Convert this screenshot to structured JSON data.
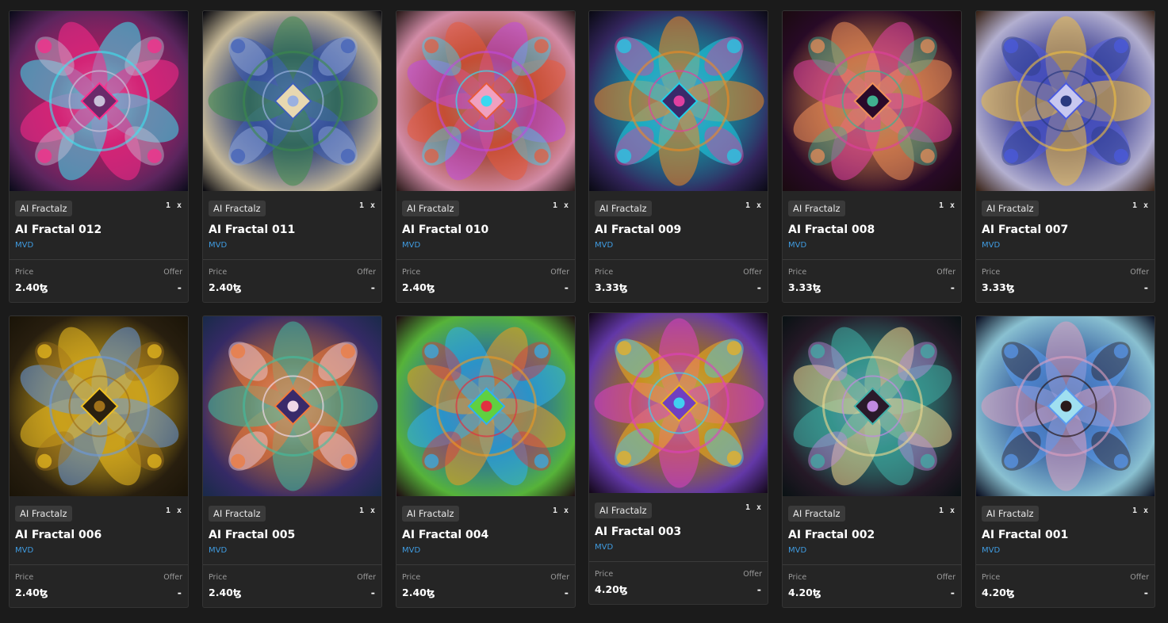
{
  "items": [
    {
      "collection": "AI Fractalz",
      "editions": "1 x",
      "title": "AI Fractal 012",
      "creator": "MVD",
      "price_label": "Price",
      "price": "2.40ꜩ",
      "offer_label": "Offer",
      "offer": "-",
      "palette": [
        "#0b0b1a",
        "#ff2a8a",
        "#3ee4f0",
        "#c8c0d8",
        "#6a2a6a"
      ]
    },
    {
      "collection": "AI Fractalz",
      "editions": "1 x",
      "title": "AI Fractal 011",
      "creator": "MVD",
      "price_label": "Price",
      "price": "2.40ꜩ",
      "offer_label": "Offer",
      "offer": "-",
      "palette": [
        "#0a0a10",
        "#4060b8",
        "#3a8a4a",
        "#9ab0e0",
        "#e8d8b0"
      ]
    },
    {
      "collection": "AI Fractalz",
      "editions": "1 x",
      "title": "AI Fractal 010",
      "creator": "MVD",
      "price_label": "Price",
      "price": "2.40ꜩ",
      "offer_label": "Offer",
      "offer": "-",
      "palette": [
        "#2a1a1a",
        "#e85a3a",
        "#c04ae0",
        "#3ad8f0",
        "#f0a0c0"
      ]
    },
    {
      "collection": "AI Fractalz",
      "editions": "1 x",
      "title": "AI Fractal 009",
      "creator": "MVD",
      "price_label": "Price",
      "price": "3.33ꜩ",
      "offer_label": "Offer",
      "offer": "-",
      "palette": [
        "#0a0a14",
        "#20d0e8",
        "#f08a20",
        "#e040a0",
        "#3a2a6a"
      ]
    },
    {
      "collection": "AI Fractalz",
      "editions": "1 x",
      "title": "AI Fractal 008",
      "creator": "MVD",
      "price_label": "Price",
      "price": "3.33ꜩ",
      "offer_label": "Offer",
      "offer": "-",
      "palette": [
        "#1a0a10",
        "#f0905a",
        "#e040a0",
        "#40b090",
        "#2a0a2a"
      ]
    },
    {
      "collection": "AI Fractalz",
      "editions": "1 x",
      "title": "AI Fractal 007",
      "creator": "MVD",
      "price_label": "Price",
      "price": "3.33ꜩ",
      "offer_label": "Offer",
      "offer": "-",
      "palette": [
        "#3a2418",
        "#4a5ae0",
        "#f0c040",
        "#2a3a80",
        "#c8c8f0"
      ]
    },
    {
      "collection": "AI Fractalz",
      "editions": "1 x",
      "title": "AI Fractal 006",
      "creator": "MVD",
      "price_label": "Price",
      "price": "2.40ꜩ",
      "offer_label": "Offer",
      "offer": "-",
      "palette": [
        "#1a1408",
        "#f0c020",
        "#6a9ae0",
        "#a0701a",
        "#2a2010"
      ]
    },
    {
      "collection": "AI Fractalz",
      "editions": "1 x",
      "title": "AI Fractal 005",
      "creator": "MVD",
      "price_label": "Price",
      "price": "2.40ꜩ",
      "offer_label": "Offer",
      "offer": "-",
      "palette": [
        "#1a2a4a",
        "#f07a3a",
        "#40c0a0",
        "#f0d8e8",
        "#3a2a6a"
      ]
    },
    {
      "collection": "AI Fractalz",
      "editions": "1 x",
      "title": "AI Fractal 004",
      "creator": "MVD",
      "price_label": "Price",
      "price": "2.40ꜩ",
      "offer_label": "Offer",
      "offer": "-",
      "palette": [
        "#1e0e12",
        "#30b0f0",
        "#f09a20",
        "#e03040",
        "#60d040"
      ]
    },
    {
      "collection": "AI Fractalz",
      "editions": "1 x",
      "title": "AI Fractal 003",
      "creator": "MVD",
      "price_label": "Price",
      "price": "4.20ꜩ",
      "offer_label": "Offer",
      "offer": "-",
      "palette": [
        "#14081a",
        "#f0b020",
        "#e040c0",
        "#40d0f0",
        "#7040c0"
      ]
    },
    {
      "collection": "AI Fractalz",
      "editions": "1 x",
      "title": "AI Fractal 002",
      "creator": "MVD",
      "price_label": "Price",
      "price": "4.20ꜩ",
      "offer_label": "Offer",
      "offer": "-",
      "palette": [
        "#0a1214",
        "#40b0a8",
        "#f0d890",
        "#c08ae0",
        "#2a1a2a"
      ]
    },
    {
      "collection": "AI Fractalz",
      "editions": "1 x",
      "title": "AI Fractal 001",
      "creator": "MVD",
      "price_label": "Price",
      "price": "4.20ꜩ",
      "offer_label": "Offer",
      "offer": "-",
      "palette": [
        "#0a0e20",
        "#5a9af0",
        "#e0a0c0",
        "#2a1a1a",
        "#a0e0f0"
      ]
    }
  ]
}
